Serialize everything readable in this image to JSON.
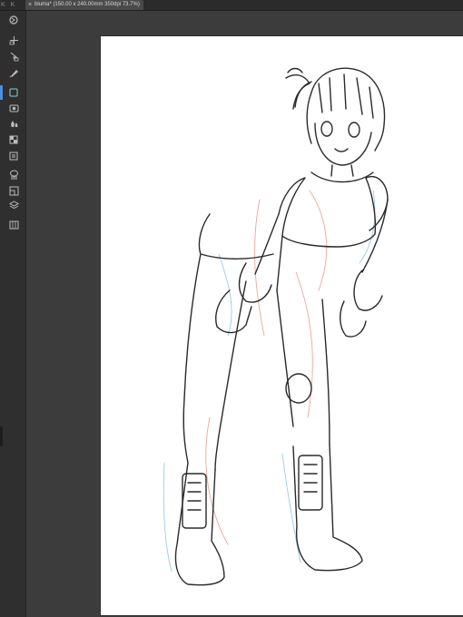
{
  "tabbar": {
    "nav_label": "K K",
    "document_tab": {
      "close_glyph": "×",
      "title": "bluma* (150.00 x 240.00mm 350dpi 73.7%)"
    }
  },
  "toolbar": {
    "tools": [
      {
        "name": "zoom-tool-icon",
        "active": false
      },
      {
        "name": "move-tool-icon",
        "active": false
      },
      {
        "name": "transform-tool-icon",
        "active": false
      },
      {
        "name": "pen-tool-icon",
        "active": true
      },
      {
        "name": "eraser-tool-icon",
        "active": false
      },
      {
        "name": "fill-tool-icon",
        "active": false
      },
      {
        "name": "gradient-tool-icon",
        "active": false
      },
      {
        "name": "text-tool-icon",
        "active": false
      },
      {
        "name": "balloon-tool-icon",
        "active": false
      },
      {
        "name": "ruler-tool-icon",
        "active": false
      },
      {
        "name": "layer-tool-icon",
        "active": false
      },
      {
        "name": "frame-tool-icon",
        "active": false
      }
    ]
  },
  "canvas": {
    "artwork": "line-art character drawing",
    "background_color": "#ffffff"
  },
  "colors": {
    "workspace": "#3c3c3c",
    "toolbar": "#2f2f2f",
    "tab_active": "#4a4a4a",
    "accent": "#4b8fe0",
    "sketch_red": "#e8927c",
    "sketch_blue": "#86c3e8",
    "line": "#2a2a2a"
  }
}
